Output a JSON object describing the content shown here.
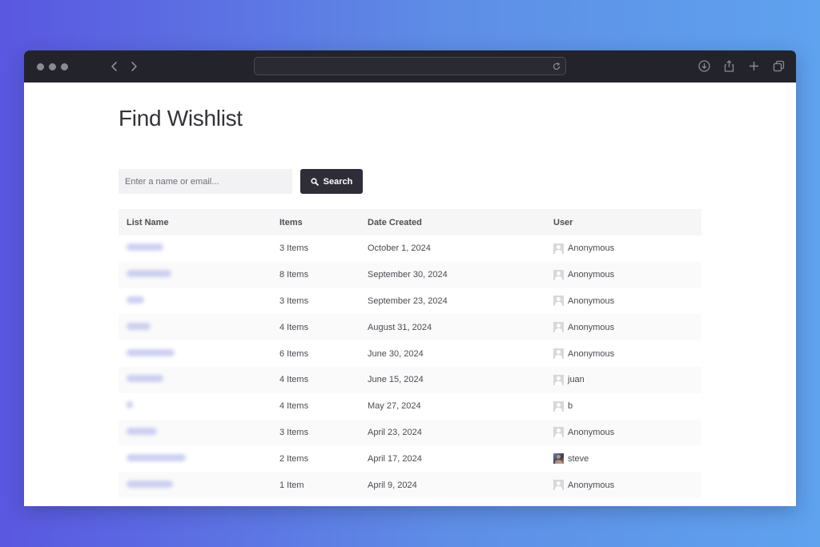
{
  "browser": {
    "url": ""
  },
  "page": {
    "title": "Find Wishlist"
  },
  "search": {
    "placeholder": "Enter a name or email...",
    "value": "",
    "button_label": "Search"
  },
  "table": {
    "columns": [
      "List Name",
      "Items",
      "Date Created",
      "User"
    ],
    "rows": [
      {
        "items": "3 Items",
        "date": "October 1, 2024",
        "user": "Anonymous",
        "avatar": "placeholder"
      },
      {
        "items": "8 Items",
        "date": "September 30, 2024",
        "user": "Anonymous",
        "avatar": "placeholder"
      },
      {
        "items": "3 Items",
        "date": "September 23, 2024",
        "user": "Anonymous",
        "avatar": "placeholder"
      },
      {
        "items": "4 Items",
        "date": "August 31, 2024",
        "user": "Anonymous",
        "avatar": "placeholder"
      },
      {
        "items": "6 Items",
        "date": "June 30, 2024",
        "user": "Anonymous",
        "avatar": "placeholder"
      },
      {
        "items": "4 Items",
        "date": "June 15, 2024",
        "user": "juan",
        "avatar": "placeholder"
      },
      {
        "items": "4 Items",
        "date": "May 27, 2024",
        "user": "b",
        "avatar": "placeholder"
      },
      {
        "items": "3 Items",
        "date": "April 23, 2024",
        "user": "Anonymous",
        "avatar": "placeholder"
      },
      {
        "items": "2 Items",
        "date": "April 17, 2024",
        "user": "steve",
        "avatar": "photo"
      },
      {
        "items": "1 Item",
        "date": "April 9, 2024",
        "user": "Anonymous",
        "avatar": "placeholder"
      }
    ]
  },
  "icons": {
    "search": "search-icon",
    "back": "chevron-left-icon",
    "forward": "chevron-right-icon",
    "reload": "reload-icon",
    "download": "download-icon",
    "share": "share-icon",
    "new_tab": "plus-icon",
    "tabs": "tabs-overview-icon"
  },
  "colors": {
    "background_start": "#5a57e0",
    "background_end": "#5fa2ee",
    "titlebar": "#23232b",
    "button": "#2f2e38",
    "blurred_link": "#c4c8ee"
  }
}
